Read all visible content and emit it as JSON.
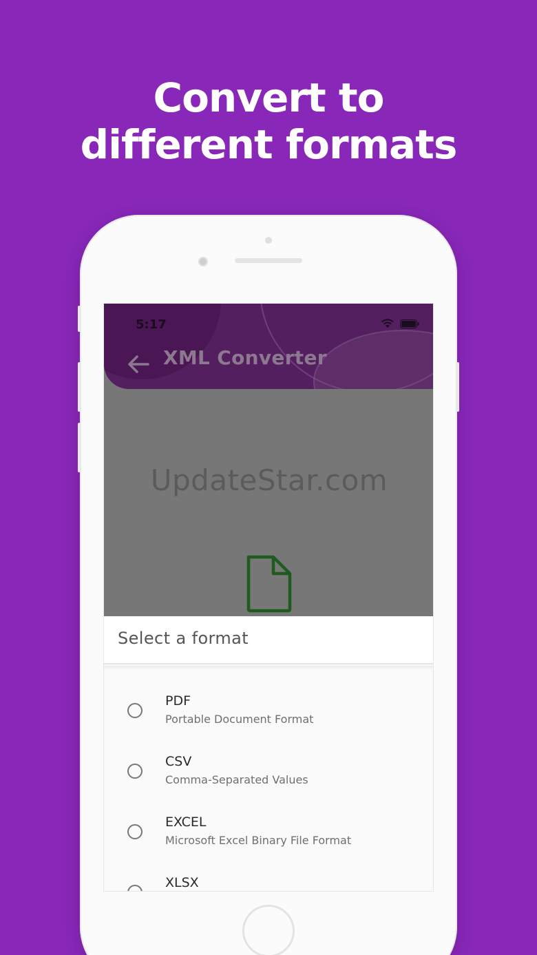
{
  "banner": {
    "line1": "Convert to",
    "line2": "different formats"
  },
  "status_bar": {
    "time": "5:17",
    "wifi_icon": "wifi-icon",
    "battery_icon": "battery-icon"
  },
  "app_bar": {
    "back_icon": "arrow-left-icon",
    "title": "XML Converter"
  },
  "overlay": {
    "watermark": "UpdateStar.com",
    "file_icon": "document-icon"
  },
  "format_sheet": {
    "title": "Select a format",
    "options": [
      {
        "name": "PDF",
        "description": "Portable Document Format",
        "selected": false
      },
      {
        "name": "CSV",
        "description": "Comma-Separated Values",
        "selected": false
      },
      {
        "name": "EXCEL",
        "description": "Microsoft Excel Binary File Format",
        "selected": false
      },
      {
        "name": "XLSX",
        "description": "",
        "selected": false
      }
    ]
  },
  "colors": {
    "background": "#8827b8",
    "header": "#541f5e",
    "overlay_gray": "#777777",
    "file_icon_green": "#1f5a1f"
  }
}
